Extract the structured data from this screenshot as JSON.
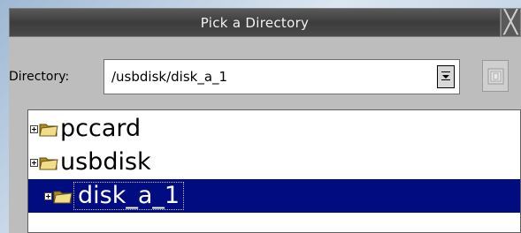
{
  "dialog": {
    "title": "Pick a Directory",
    "close_icon": "close-icon"
  },
  "directory": {
    "label": "Directory:",
    "value": "/usbdisk/disk_a_1",
    "dropdown_icon": "dropdown-icon",
    "new_folder_icon": "new-folder-icon"
  },
  "tree": {
    "items": [
      {
        "label": "pccard",
        "icon": "folder-icon",
        "selected": false
      },
      {
        "label": "usbdisk",
        "icon": "folder-icon",
        "selected": false
      },
      {
        "label": "disk_a_1",
        "icon": "folder-icon",
        "selected": true
      }
    ]
  },
  "colors": {
    "selection": "#000c80",
    "titlebar": "#4a4a4a",
    "panel": "#bdbdbd"
  }
}
